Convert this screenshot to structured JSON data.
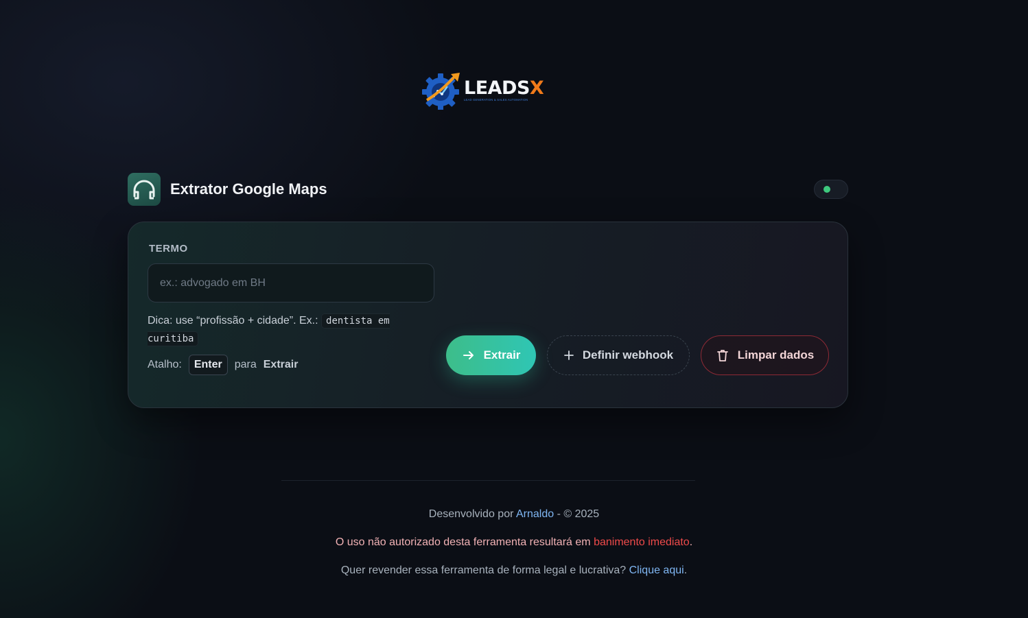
{
  "logo": {
    "wordmark_main": "LEADS",
    "wordmark_accent": "X",
    "tagline": "LEAD GENERATION & SALES AUTOMATION"
  },
  "header": {
    "title": "Extrator Google Maps",
    "app_icon": "headphones-icon",
    "status_color": "#3ec97e"
  },
  "form": {
    "term_label": "TERMO",
    "term_value": "",
    "term_placeholder": "ex.: advogado em BH",
    "tip_prefix": "Dica: use “profissão + cidade”. Ex.:",
    "tip_example": "dentista em curitiba",
    "shortcut_label": "Atalho:",
    "shortcut_key": "Enter",
    "shortcut_connector": "para",
    "shortcut_action": "Extrair"
  },
  "buttons": {
    "extract": "Extrair",
    "webhook": "Definir webhook",
    "clear": "Limpar dados"
  },
  "footer": {
    "dev_prefix": "Desenvolvido por",
    "dev_name": "Arnaldo",
    "dev_suffix": "- © 2025",
    "warning_prefix": "O uso não autorizado desta ferramenta resultará em",
    "warning_highlight": "banimento imediato",
    "warning_suffix": ".",
    "resell_prefix": "Quer revender essa ferramenta de forma legal e lucrativa?",
    "resell_link": "Clique aqui",
    "resell_suffix": "."
  },
  "colors": {
    "accent_green": "#3dbd8a",
    "danger": "#ef4a4a",
    "link": "#7fb6f3"
  }
}
